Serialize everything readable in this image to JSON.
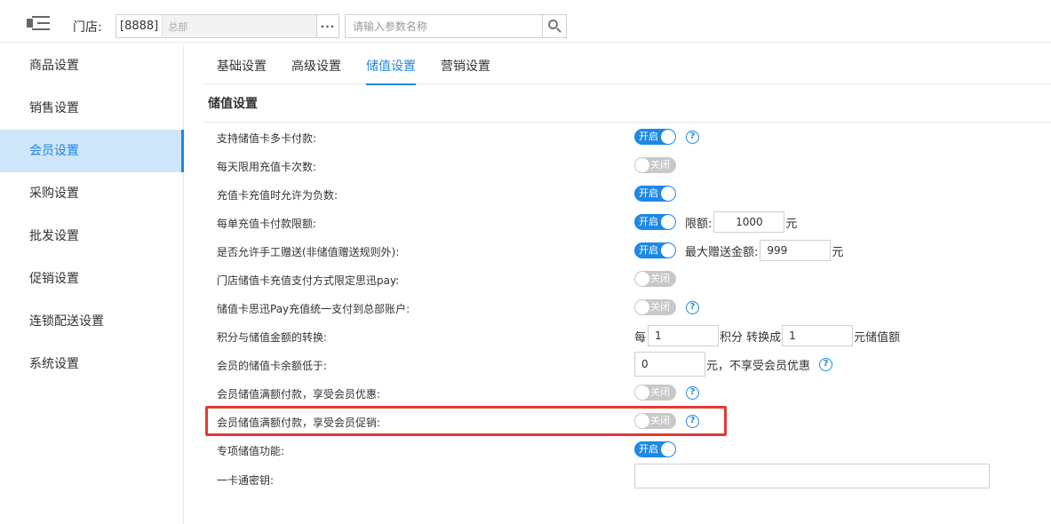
{
  "header": {
    "store_label": "门店:",
    "store_code": "[8888]",
    "store_name": "总部",
    "more_label": "···",
    "search_placeholder": "请输入参数名称"
  },
  "sidebar": {
    "items": [
      {
        "label": "商品设置"
      },
      {
        "label": "销售设置"
      },
      {
        "label": "会员设置",
        "active": true
      },
      {
        "label": "采购设置"
      },
      {
        "label": "批发设置"
      },
      {
        "label": "促销设置"
      },
      {
        "label": "连锁配送设置"
      },
      {
        "label": "系统设置"
      }
    ]
  },
  "tabs": [
    {
      "label": "基础设置"
    },
    {
      "label": "高级设置"
    },
    {
      "label": "储值设置",
      "active": true
    },
    {
      "label": "营销设置"
    }
  ],
  "section_title": "储值设置",
  "toggle_on_text": "开启",
  "toggle_off_text": "关闭",
  "help_glyph": "?",
  "settings": {
    "r1": {
      "label": "支持储值卡多卡付款:"
    },
    "r2": {
      "label": "每天限用充值卡次数:"
    },
    "r3": {
      "label": "充值卡充值时允许为负数:"
    },
    "r4": {
      "label": "每单充值卡付款限额:",
      "prefix": "限额:",
      "value": "1000",
      "suffix": "元"
    },
    "r5": {
      "label": "是否允许手工赠送(非储值赠送规则外):",
      "prefix": "最大赠送金额:",
      "value": "999",
      "suffix": "元"
    },
    "r6": {
      "label": "门店储值卡充值支付方式限定思迅pay:"
    },
    "r7": {
      "label": "储值卡思迅Pay充值统一支付到总部账户:"
    },
    "r8": {
      "label": "积分与储值金额的转换:",
      "t1": "每",
      "v1": "1",
      "t2": "积分 转换成",
      "v2": "1",
      "t3": "元储值额"
    },
    "r9": {
      "label": "会员的储值卡余额低于:",
      "value": "0",
      "suffix": "元，不享受会员优惠"
    },
    "r10": {
      "label": "会员储值满额付款，享受会员优惠:"
    },
    "r11": {
      "label": "会员储值满额付款，享受会员促销:"
    },
    "r12": {
      "label": "专项储值功能:"
    },
    "r13": {
      "label": "一卡通密钥:",
      "value": ""
    }
  }
}
